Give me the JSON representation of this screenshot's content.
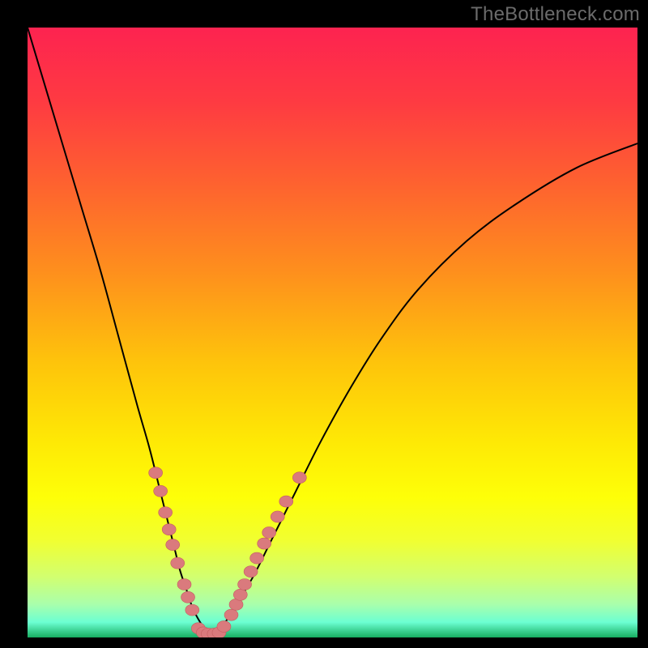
{
  "watermark": "TheBottleneck.com",
  "colors": {
    "frame": "#000000",
    "watermark": "#6b6b6b",
    "curve": "#000000",
    "markers_fill": "#da7a7d",
    "markers_stroke": "#c45d60",
    "gradient_stops": [
      {
        "offset": 0.0,
        "color": "#fd2350"
      },
      {
        "offset": 0.12,
        "color": "#fe3a42"
      },
      {
        "offset": 0.25,
        "color": "#fe6030"
      },
      {
        "offset": 0.4,
        "color": "#fe8f1d"
      },
      {
        "offset": 0.55,
        "color": "#fec40b"
      },
      {
        "offset": 0.68,
        "color": "#fee905"
      },
      {
        "offset": 0.77,
        "color": "#feff08"
      },
      {
        "offset": 0.84,
        "color": "#f1ff30"
      },
      {
        "offset": 0.9,
        "color": "#d2ff6f"
      },
      {
        "offset": 0.945,
        "color": "#aaffab"
      },
      {
        "offset": 0.975,
        "color": "#6cffd2"
      },
      {
        "offset": 1.0,
        "color": "#17ae61"
      }
    ]
  },
  "chart_data": {
    "type": "line",
    "title": "",
    "xlabel": "",
    "ylabel": "",
    "xlim": [
      0,
      100
    ],
    "ylim": [
      0,
      100
    ],
    "series": [
      {
        "name": "bottleneck-curve-left",
        "x": [
          0,
          3,
          6,
          9,
          12,
          15,
          18,
          20,
          22,
          24,
          25,
          26,
          27,
          28,
          29,
          30
        ],
        "y": [
          100,
          90,
          80,
          70,
          60,
          49,
          38,
          31,
          23,
          15,
          11,
          8,
          5,
          3,
          1.5,
          0.8
        ]
      },
      {
        "name": "bottleneck-curve-right",
        "x": [
          30,
          32,
          34,
          37,
          40,
          44,
          48,
          53,
          58,
          64,
          72,
          80,
          90,
          100
        ],
        "y": [
          0.8,
          2,
          5,
          10,
          16,
          24,
          32,
          41,
          49,
          57,
          65,
          71,
          77,
          81
        ]
      }
    ],
    "markers": {
      "name": "sample-points",
      "points": [
        {
          "x": 21.0,
          "y": 27.0
        },
        {
          "x": 21.8,
          "y": 24.0
        },
        {
          "x": 22.6,
          "y": 20.5
        },
        {
          "x": 23.2,
          "y": 17.7
        },
        {
          "x": 23.8,
          "y": 15.2
        },
        {
          "x": 24.6,
          "y": 12.2
        },
        {
          "x": 25.7,
          "y": 8.7
        },
        {
          "x": 26.3,
          "y": 6.6
        },
        {
          "x": 27.0,
          "y": 4.5
        },
        {
          "x": 28.0,
          "y": 1.5
        },
        {
          "x": 28.8,
          "y": 0.8
        },
        {
          "x": 29.6,
          "y": 0.6
        },
        {
          "x": 30.6,
          "y": 0.6
        },
        {
          "x": 31.4,
          "y": 0.8
        },
        {
          "x": 32.2,
          "y": 1.8
        },
        {
          "x": 33.4,
          "y": 3.7
        },
        {
          "x": 34.2,
          "y": 5.4
        },
        {
          "x": 34.9,
          "y": 7.0
        },
        {
          "x": 35.6,
          "y": 8.7
        },
        {
          "x": 36.6,
          "y": 10.8
        },
        {
          "x": 37.6,
          "y": 13.0
        },
        {
          "x": 38.8,
          "y": 15.4
        },
        {
          "x": 39.6,
          "y": 17.2
        },
        {
          "x": 41.0,
          "y": 19.8
        },
        {
          "x": 42.4,
          "y": 22.3
        },
        {
          "x": 44.6,
          "y": 26.2
        }
      ]
    }
  }
}
